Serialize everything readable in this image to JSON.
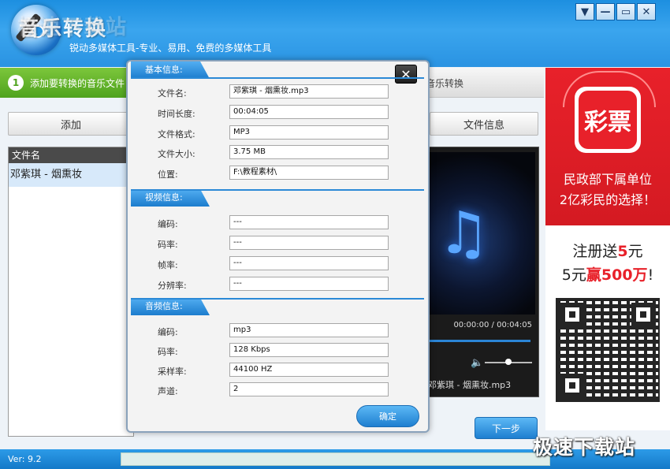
{
  "header": {
    "title": "音乐转换",
    "title_overlay": "极速下载站",
    "subtitle": "锐动多媒体工具-专业、易用、免费的多媒体工具",
    "window_controls": {
      "menu": "▼",
      "minimize": "—",
      "maximize": "▭",
      "close": "✕"
    }
  },
  "steps": {
    "step1_num": "1",
    "step1_label": "添加要转换的音乐文件",
    "step3_label": "音乐转换"
  },
  "left": {
    "add_label": "添加",
    "list_header": "文件名",
    "files": [
      "邓紫琪 - 烟熏妆"
    ]
  },
  "right": {
    "fileinfo_label": "文件信息",
    "time_readout": "00:00:00 / 00:04:05",
    "player_filename": "邓紫琪 - 烟熏妆.mp3",
    "next_label": "下一步"
  },
  "ad": {
    "logo_text": "彩票",
    "line1": "民政部下属单位",
    "line2": "2亿彩民的选择！",
    "promo1_a": "注册送",
    "promo1_b": "5",
    "promo1_c": "元",
    "promo2_a": "5元",
    "promo2_b": "赢500万",
    "promo2_c": "!"
  },
  "status": {
    "version": "Ver: 9.2",
    "watermark": "极速下载站"
  },
  "dialog": {
    "close_label": "✕",
    "basic": {
      "title": "基本信息:",
      "fields": [
        {
          "label": "文件名:",
          "value": "邓紫琪 - 烟熏妆.mp3"
        },
        {
          "label": "时间长度:",
          "value": "00:04:05"
        },
        {
          "label": "文件格式:",
          "value": "MP3"
        },
        {
          "label": "文件大小:",
          "value": "3.75 MB"
        },
        {
          "label": "位置:",
          "value": "F:\\教程素材\\"
        }
      ]
    },
    "video": {
      "title": "视频信息:",
      "fields": [
        {
          "label": "编码:",
          "value": "---"
        },
        {
          "label": "码率:",
          "value": "---"
        },
        {
          "label": "帧率:",
          "value": "---"
        },
        {
          "label": "分辨率:",
          "value": "---"
        }
      ]
    },
    "audio": {
      "title": "音频信息:",
      "fields": [
        {
          "label": "编码:",
          "value": "mp3"
        },
        {
          "label": "码率:",
          "value": "128 Kbps"
        },
        {
          "label": "采样率:",
          "value": "44100 HZ"
        },
        {
          "label": "声道:",
          "value": "2"
        }
      ]
    },
    "ok_label": "确定"
  }
}
